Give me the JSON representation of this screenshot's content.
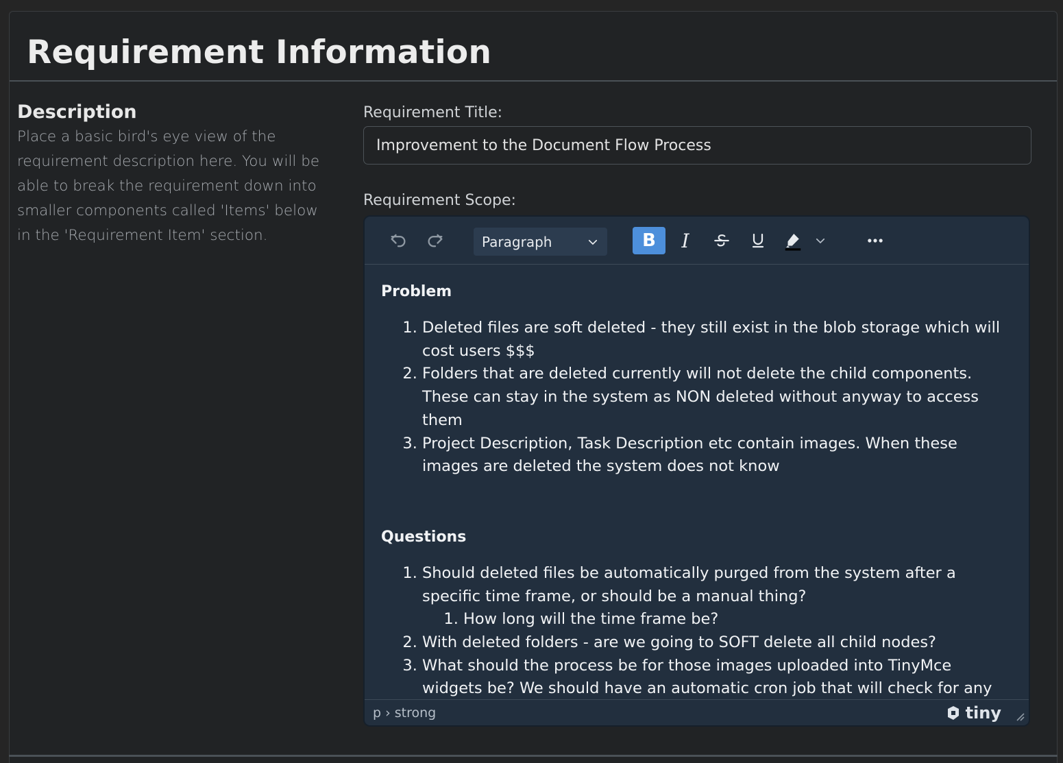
{
  "header": {
    "title": "Requirement Information"
  },
  "description": {
    "heading": "Description",
    "text": "Place a basic bird's eye view of the requirement description here. You will be able to break the requirement down into smaller components called 'Items' below in the 'Requirement Item' section."
  },
  "title_field": {
    "label": "Requirement Title:",
    "value": "Improvement to the Document Flow Process"
  },
  "scope_field": {
    "label": "Requirement Scope:"
  },
  "editor": {
    "toolbar": {
      "undo_icon": "undo-icon",
      "redo_icon": "redo-icon",
      "block_format": "Paragraph",
      "bold": "B",
      "italic": "I",
      "more_icon": "more-icon",
      "accent": "#4d8fdb"
    },
    "content": {
      "problem_heading": "Problem",
      "problems": [
        "Deleted files are soft deleted - they still exist in the blob storage which will cost users $$$",
        "Folders that are deleted currently will not delete the child components. These can stay in the system as NON deleted without anyway to access them",
        "Project Description, Task Description etc contain images. When these images are deleted the system does not know"
      ],
      "questions_heading": "Questions",
      "questions": [
        "Should deleted files be automatically purged from the system after a specific time frame, or should be a manual thing?",
        "How long will the time frame be?",
        "With deleted folders - are we going to SOFT delete all child nodes?",
        "What should the process be for those images uploaded into TinyMce widgets be? We should have an automatic cron job that will check for any images and if they still exist"
      ]
    },
    "statusbar": {
      "path": "p › strong",
      "brand": "tiny"
    }
  }
}
